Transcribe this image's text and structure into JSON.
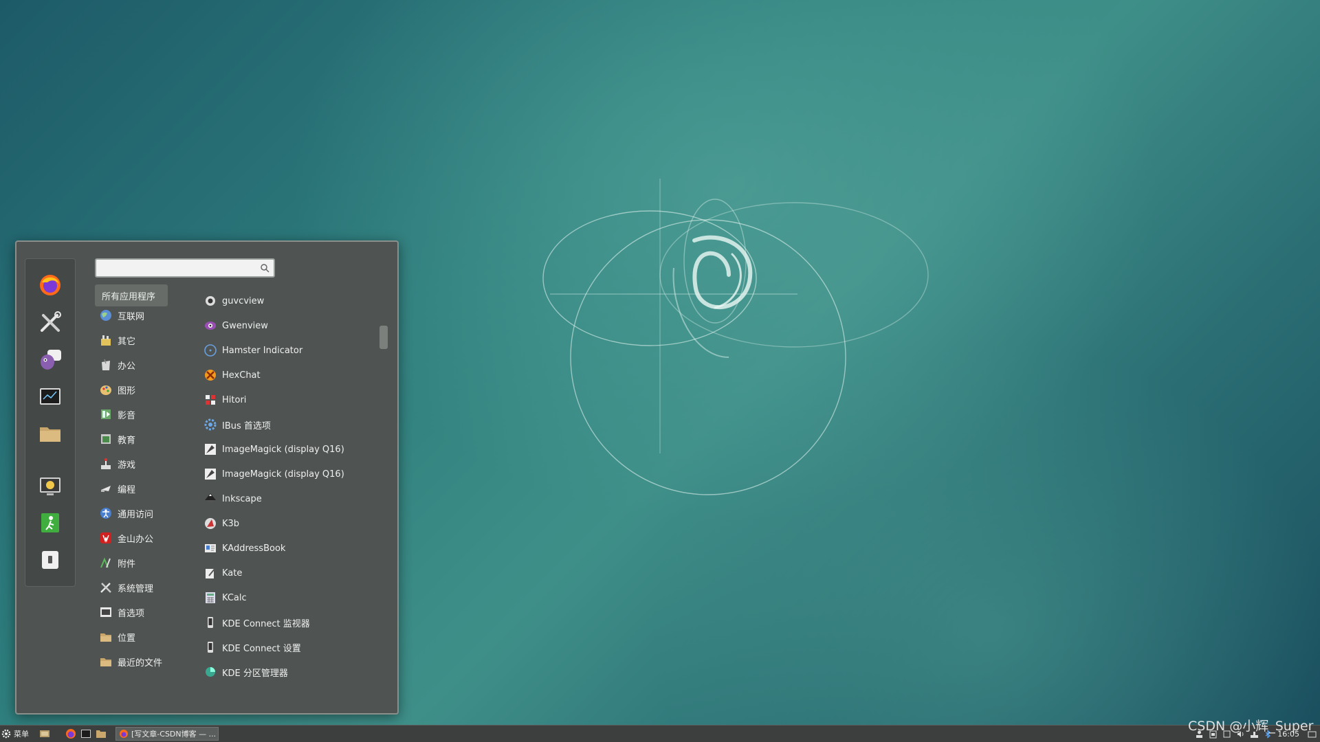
{
  "search": {
    "placeholder": ""
  },
  "favorites": [
    {
      "icon": "firefox-icon"
    },
    {
      "icon": "tools-icon"
    },
    {
      "icon": "pidgin-icon"
    },
    {
      "icon": "terminal-icon"
    },
    {
      "icon": "folder-icon"
    },
    {
      "icon": "screensaver-lock-icon"
    },
    {
      "icon": "logout-icon"
    },
    {
      "icon": "shutdown-icon"
    }
  ],
  "categories": [
    {
      "label": "所有应用程序",
      "icon": "all-apps-icon",
      "active": true
    },
    {
      "label": "互联网",
      "icon": "internet-icon"
    },
    {
      "label": "其它",
      "icon": "other-icon"
    },
    {
      "label": "办公",
      "icon": "office-icon"
    },
    {
      "label": "图形",
      "icon": "graphics-icon"
    },
    {
      "label": "影音",
      "icon": "multimedia-icon"
    },
    {
      "label": "教育",
      "icon": "education-icon"
    },
    {
      "label": "游戏",
      "icon": "games-icon"
    },
    {
      "label": "编程",
      "icon": "programming-icon"
    },
    {
      "label": "通用访问",
      "icon": "accessibility-icon"
    },
    {
      "label": "金山办公",
      "icon": "wps-office-icon"
    },
    {
      "label": "附件",
      "icon": "accessories-icon"
    },
    {
      "label": "系统管理",
      "icon": "system-admin-icon"
    },
    {
      "label": "首选项",
      "icon": "preferences-icon"
    },
    {
      "label": "位置",
      "icon": "places-icon"
    },
    {
      "label": "最近的文件",
      "icon": "recent-files-icon"
    }
  ],
  "apps": [
    {
      "label": "guvcview",
      "icon": "webcam-icon"
    },
    {
      "label": "Gwenview",
      "icon": "gwenview-icon"
    },
    {
      "label": "Hamster Indicator",
      "icon": "hamster-icon"
    },
    {
      "label": "HexChat",
      "icon": "hexchat-icon"
    },
    {
      "label": "Hitori",
      "icon": "hitori-icon"
    },
    {
      "label": "IBus 首选项",
      "icon": "ibus-gear-icon"
    },
    {
      "label": "ImageMagick (display Q16)",
      "icon": "imagemagick-icon"
    },
    {
      "label": "ImageMagick (display Q16)",
      "icon": "imagemagick-icon"
    },
    {
      "label": "Inkscape",
      "icon": "inkscape-icon"
    },
    {
      "label": "K3b",
      "icon": "k3b-icon"
    },
    {
      "label": "KAddressBook",
      "icon": "addressbook-icon"
    },
    {
      "label": "Kate",
      "icon": "kate-icon"
    },
    {
      "label": "KCalc",
      "icon": "calculator-icon"
    },
    {
      "label": "KDE Connect 监视器",
      "icon": "phone-icon"
    },
    {
      "label": "KDE Connect 设置",
      "icon": "phone-icon"
    },
    {
      "label": "KDE 分区管理器",
      "icon": "partition-icon"
    }
  ],
  "taskbar": {
    "menu_label": "菜单",
    "window_title": "[写文章-CSDN博客 — ...",
    "clock": "16:05"
  },
  "watermark": "CSDN @小辉_Super"
}
